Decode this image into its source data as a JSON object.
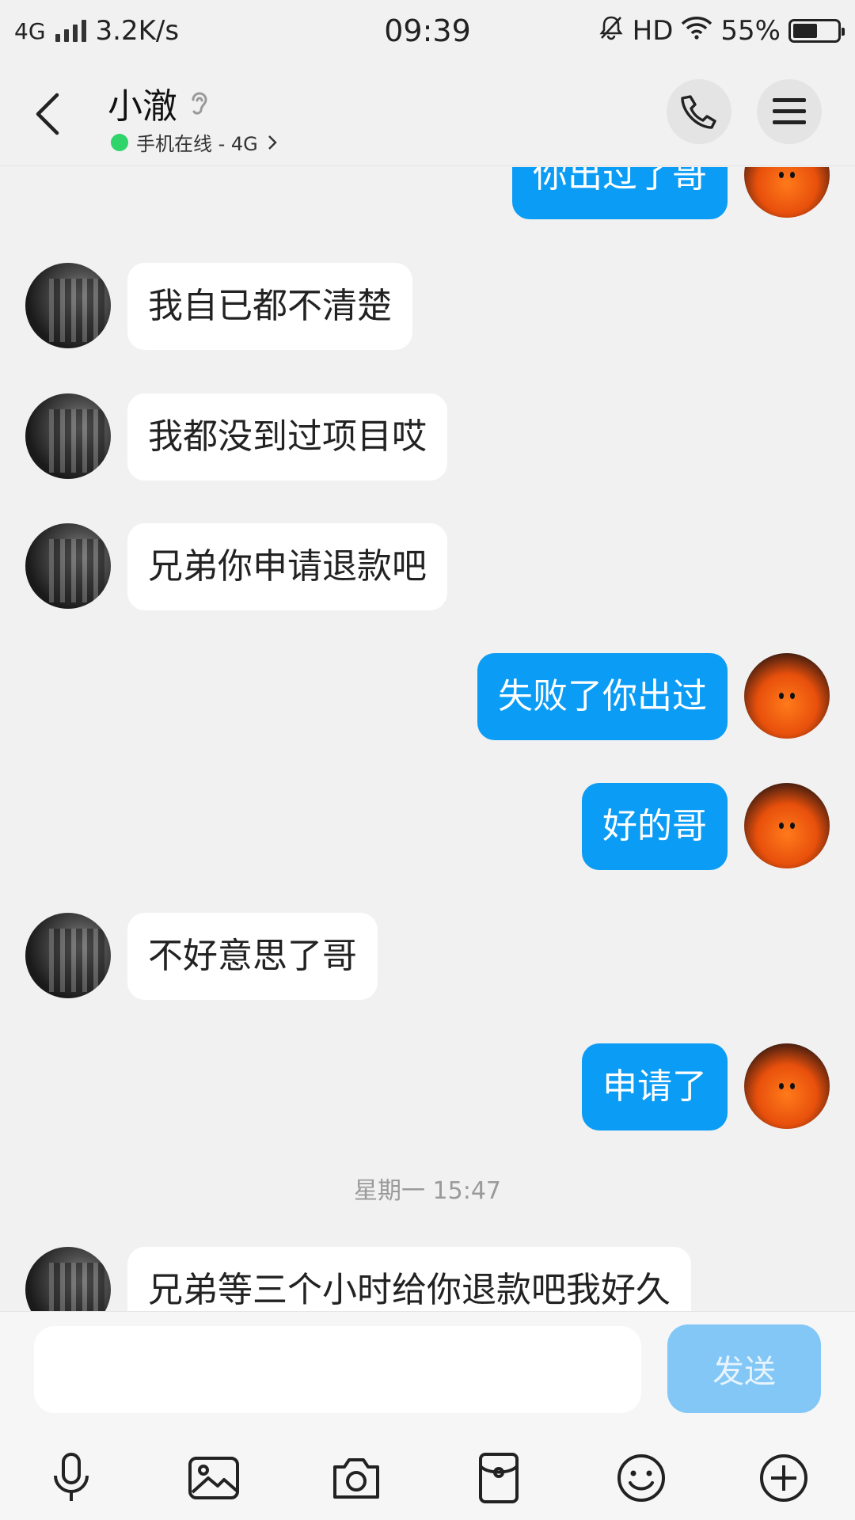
{
  "statusbar": {
    "network": "4G",
    "speed": "3.2K/s",
    "time": "09:39",
    "hd": "HD",
    "battery": "55%",
    "battery_level": 0.55
  },
  "header": {
    "title": "小澈",
    "subtitle": "手机在线 - 4G"
  },
  "messages": [
    {
      "side": "out",
      "text": "你出过了哥"
    },
    {
      "side": "in",
      "text": "我自已都不清楚"
    },
    {
      "side": "in",
      "text": "我都没到过项目哎"
    },
    {
      "side": "in",
      "text": "兄弟你申请退款吧"
    },
    {
      "side": "out",
      "text": "失败了你出过"
    },
    {
      "side": "out",
      "text": "好的哥"
    },
    {
      "side": "in",
      "text": "不好意思了哥"
    },
    {
      "side": "out",
      "text": "申请了"
    },
    {
      "side": "in",
      "text": "兄弟等三个小时给你退款吧我好久"
    }
  ],
  "timestamp": "星期一 15:47",
  "composer": {
    "placeholder": "",
    "send_label": "发送"
  },
  "toolbar": [
    "mic-icon",
    "image-icon",
    "camera-icon",
    "red-packet-icon",
    "emoji-icon",
    "plus-icon"
  ]
}
